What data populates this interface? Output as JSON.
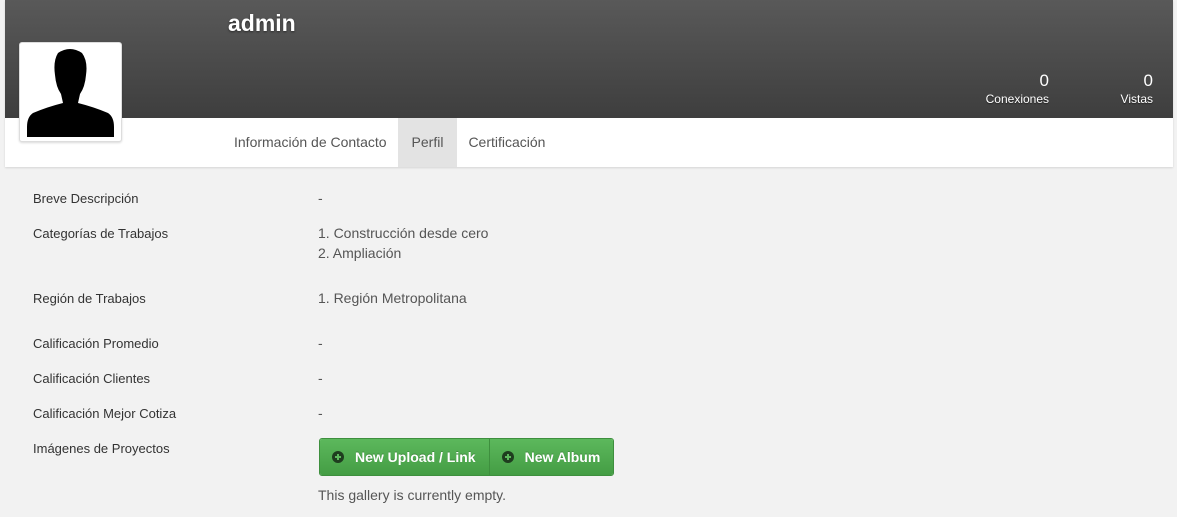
{
  "profile": {
    "username": "admin",
    "stats": [
      {
        "value": "0",
        "label": "Conexiones"
      },
      {
        "value": "0",
        "label": "Vistas"
      }
    ],
    "avatar_icon": "user-silhouette-icon"
  },
  "tabs": [
    {
      "label": "Información de Contacto",
      "active": false
    },
    {
      "label": "Perfil",
      "active": true
    },
    {
      "label": "Certificación",
      "active": false
    }
  ],
  "details": {
    "breve_descripcion": {
      "label": "Breve Descripción",
      "value": "-"
    },
    "categorias": {
      "label": "Categorías de Trabajos",
      "values": [
        "1. Construcción desde cero",
        "2. Ampliación"
      ]
    },
    "region": {
      "label": "Región de Trabajos",
      "values": [
        "1. Región Metropolitana"
      ]
    },
    "calificacion_promedio": {
      "label": "Calificación Promedio",
      "value": "-"
    },
    "calificacion_clientes": {
      "label": "Calificación Clientes",
      "value": "-"
    },
    "calificacion_mejor_cotiza": {
      "label": "Calificación Mejor Cotiza",
      "value": "-"
    },
    "imagenes": {
      "label": "Imágenes de Proyectos"
    }
  },
  "gallery": {
    "new_upload_label": "New Upload / Link",
    "new_album_label": "New Album",
    "empty_text": "This gallery is currently empty.",
    "button_color": "#5cb85c"
  },
  "colors": {
    "cover": "#4a4a4a",
    "page_background": "#f2f2f2",
    "active_tab": "#e3e3e3"
  }
}
